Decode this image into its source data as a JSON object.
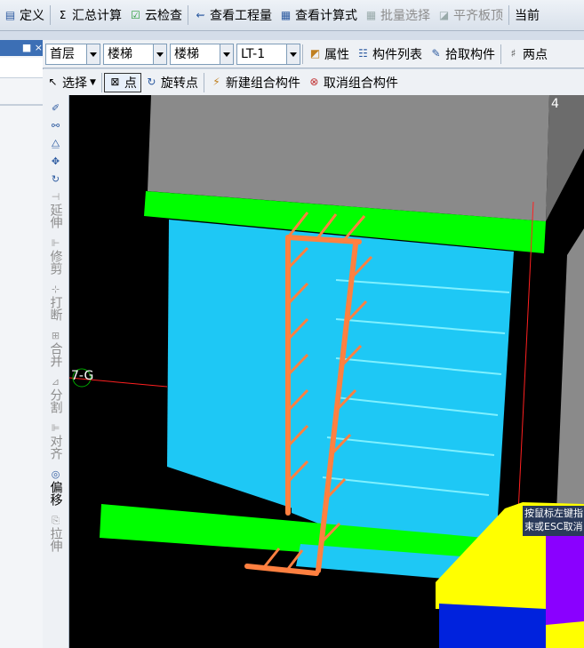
{
  "menubar": {
    "items": [
      {
        "label": "定义",
        "icon": "define-icon",
        "enabled": true
      },
      {
        "label": "汇总计算",
        "icon": "sigma-icon",
        "enabled": true
      },
      {
        "label": "云检查",
        "icon": "cloud-check-icon",
        "enabled": true
      },
      {
        "label": "查看工程量",
        "icon": "view-quantity-icon",
        "enabled": true
      },
      {
        "label": "查看计算式",
        "icon": "view-formula-icon",
        "enabled": true
      },
      {
        "label": "批量选择",
        "icon": "batch-select-icon",
        "enabled": false
      },
      {
        "label": "平齐板顶",
        "icon": "align-slab-icon",
        "enabled": false
      },
      {
        "label": "当前",
        "icon": "",
        "enabled": true
      }
    ]
  },
  "panel": {
    "pin": "■ ×"
  },
  "selectors": {
    "floor": "首层",
    "category": "楼梯",
    "type": "楼梯",
    "name": "LT-1"
  },
  "row2_tools": [
    {
      "label": "属性",
      "icon": "properties-icon"
    },
    {
      "label": "构件列表",
      "icon": "component-list-icon"
    },
    {
      "label": "拾取构件",
      "icon": "pick-icon"
    },
    {
      "label": "两点",
      "icon": "two-point-icon"
    }
  ],
  "row3_tools": {
    "select": "选择",
    "point": "点",
    "rotate_point": "旋转点",
    "new_group": "新建组合构件",
    "cancel_group": "取消组合构件"
  },
  "side_tools": [
    {
      "label": "",
      "icon": "brush-icon",
      "enabled": true
    },
    {
      "label": "",
      "icon": "copy-icon",
      "enabled": true
    },
    {
      "label": "",
      "icon": "mirror-icon",
      "enabled": true
    },
    {
      "label": "",
      "icon": "move-icon",
      "enabled": true
    },
    {
      "label": "",
      "icon": "rotate-icon",
      "enabled": true
    },
    {
      "label": "延伸",
      "icon": "extend-icon",
      "enabled": false
    },
    {
      "label": "修剪",
      "icon": "trim-icon",
      "enabled": false
    },
    {
      "label": "打断",
      "icon": "break-icon",
      "enabled": false
    },
    {
      "label": "合并",
      "icon": "merge-icon",
      "enabled": false
    },
    {
      "label": "分割",
      "icon": "split-icon",
      "enabled": false
    },
    {
      "label": "对齐",
      "icon": "align-icon",
      "enabled": false
    },
    {
      "label": "偏移",
      "icon": "offset-icon",
      "enabled": true
    },
    {
      "label": "拉伸",
      "icon": "stretch-icon",
      "enabled": false
    }
  ],
  "viewport": {
    "coord_label": "7-G",
    "axis_label": "4",
    "tooltip_line1": "按鼠标左键指",
    "tooltip_line2": "束或ESC取消",
    "colors": {
      "slab": "#00ff00",
      "stair": "#1ec8f5",
      "rebar": "#ff8040",
      "wall": "#8a8a8a",
      "yellow": "#ffff00",
      "purple": "#8a00ff",
      "blue": "#0022dd"
    }
  }
}
